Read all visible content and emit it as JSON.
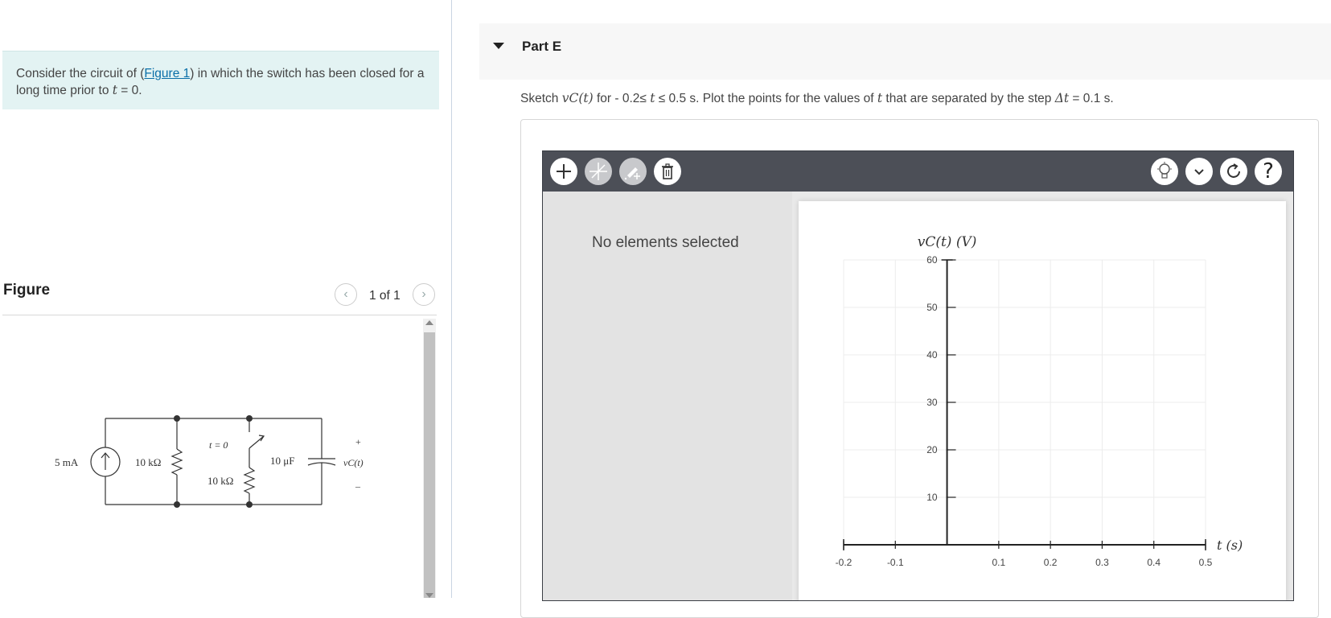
{
  "problem": {
    "text_before": "Consider the circuit of (",
    "figure_link": "Figure 1",
    "text_after": ") in which the switch has been closed for a long time prior to ",
    "t_symbol": "t",
    "equals_zero": " = 0."
  },
  "figure_panel": {
    "title": "Figure",
    "pager_text": "1 of 1",
    "prev_icon": "chevron-left-icon",
    "next_icon": "chevron-right-icon"
  },
  "circuit": {
    "source_label": "5 mA",
    "r1_label": "10 kΩ",
    "switch_label": "t = 0",
    "r2_label": "10 kΩ",
    "cap_label": "10 μF",
    "vc_label": "vC(t)",
    "plus": "+",
    "minus": "–"
  },
  "part": {
    "title": "Part E",
    "instruction_parts": [
      "Sketch ",
      "vC(t)",
      " for - 0.2≤ ",
      "t",
      " ≤ 0.5 s. Plot the points for the values of ",
      "t",
      " that are separated by the step ",
      "Δt",
      " = 0.1 s."
    ]
  },
  "toolbar": {
    "left_tools": [
      "plus-icon",
      "line-icon",
      "pencil-plus-icon",
      "trash-icon"
    ],
    "right_tools": [
      "lightbulb-icon",
      "chevron-down-icon",
      "reset-icon",
      "help-icon"
    ],
    "help_glyph": "?"
  },
  "side_panel": {
    "status": "No elements selected"
  },
  "chart_data": {
    "type": "scatter",
    "xlabel": "t (s)",
    "ylabel": "vC(t) (V)",
    "xlim": [
      -0.2,
      0.5
    ],
    "ylim": [
      0,
      60
    ],
    "x_ticks": [
      "-0.2",
      "-0.1",
      "0.1",
      "0.2",
      "0.3",
      "0.4",
      "0.5"
    ],
    "y_ticks": [
      "10",
      "20",
      "30",
      "40",
      "50",
      "60"
    ],
    "grid": true,
    "series": []
  }
}
